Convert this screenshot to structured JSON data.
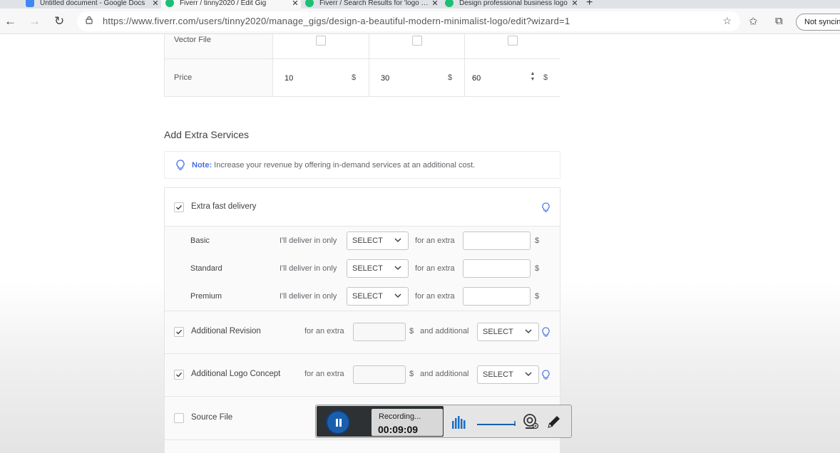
{
  "browser": {
    "tabs": [
      {
        "title": "Untitled document - Google Docs",
        "favicon": "docs-icon",
        "active": false
      },
      {
        "title": "Fiverr / tinny2020 / Edit Gig",
        "favicon": "fiverr-icon",
        "active": true
      },
      {
        "title": "Fiverr / Search Results for 'logo design'",
        "favicon": "fiverr-icon",
        "active": false
      },
      {
        "title": "Design professional business logo",
        "favicon": "fiverr-icon",
        "active": false
      }
    ],
    "url": "https://www.fiverr.com/users/tinny2020/manage_gigs/design-a-beautiful-modern-minimalist-logo/edit?wizard=1",
    "sync_label": "Not syncing"
  },
  "pricing": {
    "vector_file_label": "Vector File",
    "price_label": "Price",
    "prices": [
      "10",
      "30",
      "60"
    ],
    "currency": "$"
  },
  "extras": {
    "section_title": "Add Extra Services",
    "note_label": "Note:",
    "note_text": "Increase your revenue by offering in-demand services at an additional cost.",
    "fast_delivery": {
      "label": "Extra fast delivery",
      "checked": true,
      "tiers": [
        {
          "name": "Basic",
          "deliver_label": "I'll deliver in only",
          "select": "SELECT",
          "extra_label": "for an extra",
          "currency": "$"
        },
        {
          "name": "Standard",
          "deliver_label": "I'll deliver in only",
          "select": "SELECT",
          "extra_label": "for an extra",
          "currency": "$"
        },
        {
          "name": "Premium",
          "deliver_label": "I'll deliver in only",
          "select": "SELECT",
          "extra_label": "for an extra",
          "currency": "$"
        }
      ]
    },
    "additional_revision": {
      "label": "Additional Revision",
      "checked": true,
      "extra_label": "for an extra",
      "currency": "$",
      "additional_label": "and additional",
      "select": "SELECT"
    },
    "additional_logo_concept": {
      "label": "Additional Logo Concept",
      "checked": true,
      "extra_label": "for an extra",
      "currency": "$",
      "additional_label": "and additional",
      "select": "SELECT"
    },
    "source_file": {
      "label": "Source File",
      "checked": false
    }
  },
  "recorder": {
    "status": "Recording...",
    "time": "00:09:09"
  },
  "colors": {
    "accent_blue": "#446ee7",
    "recorder_blue": "#1a5fad",
    "border": "#e4e5e7"
  }
}
